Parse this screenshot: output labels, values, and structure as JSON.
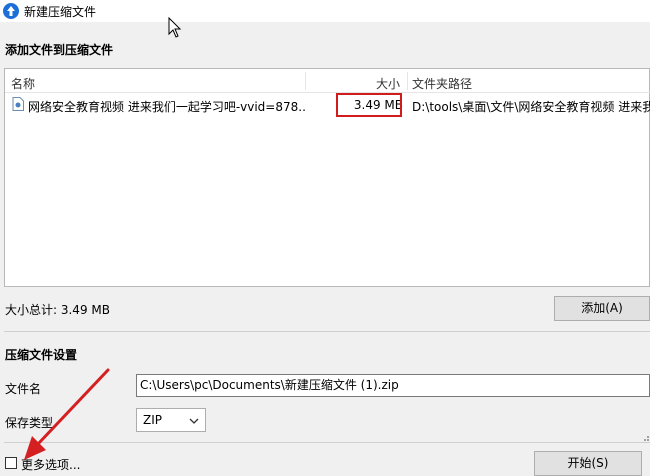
{
  "window": {
    "title": "新建压缩文件"
  },
  "add_section": {
    "title": "添加文件到压缩文件",
    "columns": {
      "name": "名称",
      "size": "大小",
      "path": "文件夹路径"
    },
    "files": [
      {
        "name": "网络安全教育视频 进来我们一起学习吧-vvid=878...",
        "size": "3.49 MB",
        "path": "D:\\tools\\桌面\\文件\\网络安全教育视频 进来我"
      }
    ],
    "total_label": "大小总计: 3.49 MB",
    "add_button": "添加(A)"
  },
  "settings": {
    "title": "压缩文件设置",
    "filename_label": "文件名",
    "filename_value": "C:\\Users\\pc\\Documents\\新建压缩文件 (1).zip",
    "type_label": "保存类型",
    "type_value": "ZIP"
  },
  "footer": {
    "more_options": "更多选项...",
    "start_button": "开始(S)"
  },
  "colors": {
    "highlight": "#d01c1c",
    "annotation_arrow": "#d42020"
  }
}
